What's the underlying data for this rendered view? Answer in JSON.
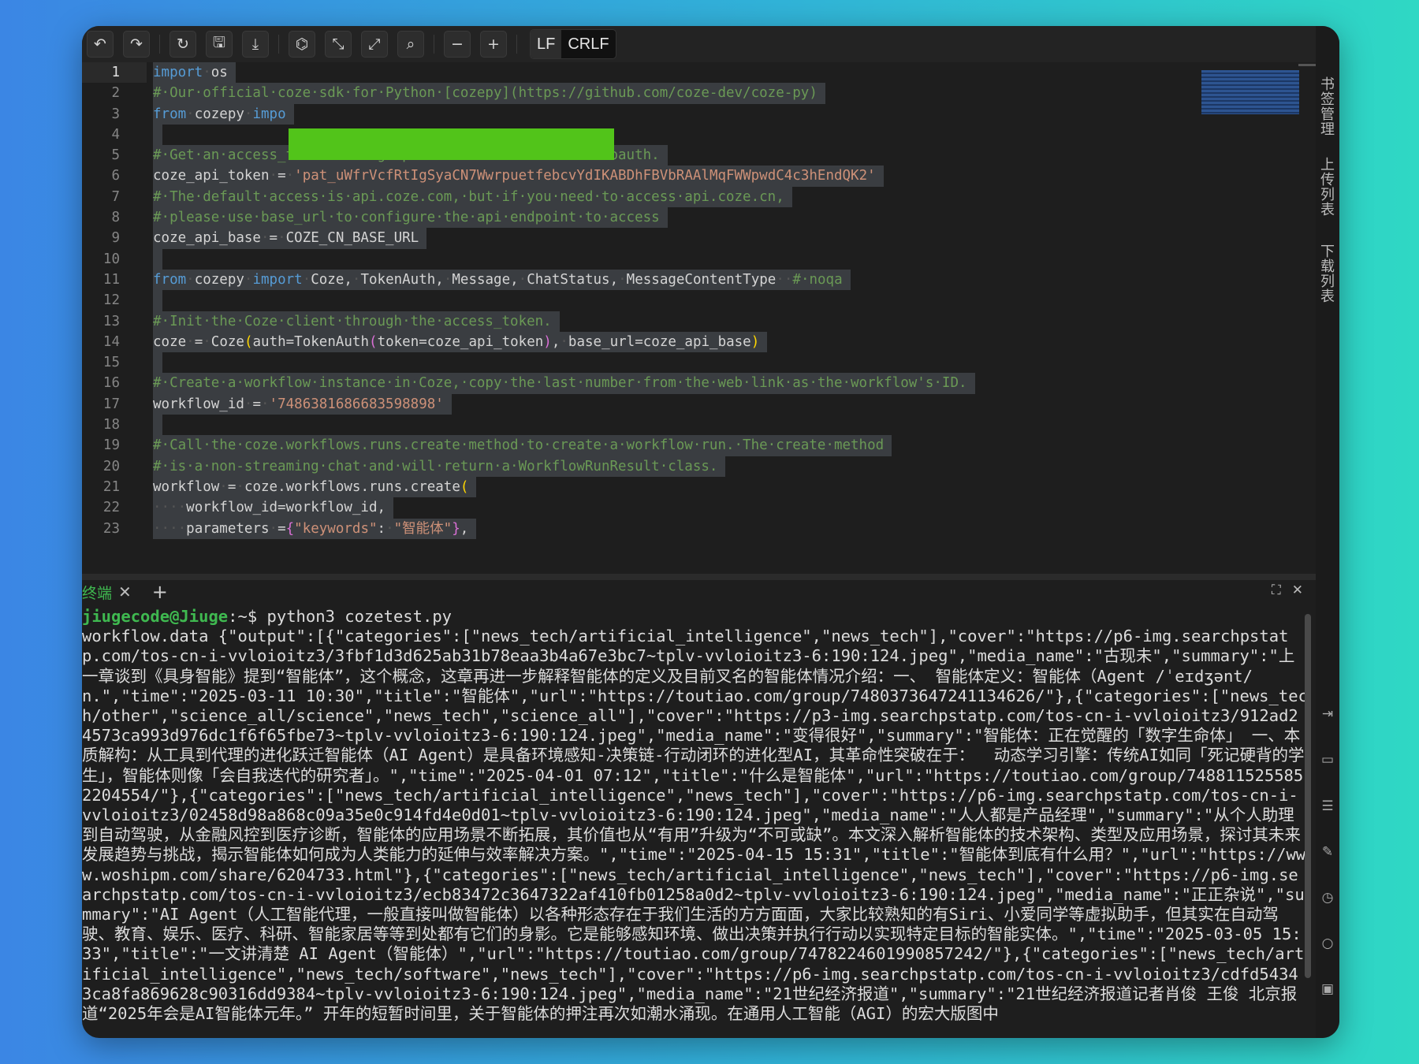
{
  "toolbar": {
    "buttons": [
      {
        "name": "undo-icon",
        "glyph": "↶"
      },
      {
        "name": "redo-icon",
        "glyph": "↷"
      },
      {
        "name": "refresh-icon",
        "glyph": "↻"
      },
      {
        "name": "save-icon",
        "glyph": "🖫"
      },
      {
        "name": "download-icon",
        "glyph": "⤓"
      },
      {
        "name": "compass-icon",
        "glyph": "⌬"
      },
      {
        "name": "collapse-icon",
        "glyph": "⤡"
      },
      {
        "name": "expand-icon",
        "glyph": "⤢"
      },
      {
        "name": "search-icon",
        "glyph": "⌕"
      },
      {
        "name": "zoom-out-icon",
        "glyph": "−"
      },
      {
        "name": "zoom-in-icon",
        "glyph": "+"
      }
    ],
    "eol_lf": "LF",
    "eol_crlf": "CRLF"
  },
  "editor": {
    "lines": [
      {
        "n": "1",
        "segments": [
          [
            "kw",
            "import"
          ],
          [
            "dot",
            "·"
          ],
          [
            "",
            "os"
          ]
        ]
      },
      {
        "n": "2",
        "segments": [
          [
            "cm",
            "#·Our·official·coze·sdk·for·Python·[cozepy](https://github.com/coze-dev/coze-py)"
          ]
        ]
      },
      {
        "n": "3",
        "segments": [
          [
            "kw",
            "from"
          ],
          [
            "dot",
            "·"
          ],
          [
            "",
            "cozepy"
          ],
          [
            "dot",
            "·"
          ],
          [
            "kw",
            "impo"
          ]
        ]
      },
      {
        "n": "4",
        "segments": []
      },
      {
        "n": "5",
        "segments": [
          [
            "cm",
            "#·Get·an·access_token·through·personal·access·token·or·oauth."
          ]
        ]
      },
      {
        "n": "6",
        "segments": [
          [
            "",
            "coze_api_token"
          ],
          [
            "dot",
            "·"
          ],
          [
            "",
            "="
          ],
          [
            "dot",
            "·"
          ],
          [
            "str",
            "'pat_uWfrVcfRtIgSyaCN7WwrpuetfebcvYdIKABDhFBVbRAAlMqFWWpwdC4c3hEndQK2'"
          ]
        ]
      },
      {
        "n": "7",
        "segments": [
          [
            "cm",
            "#·The·default·access·is·api.coze.com,·but·if·you·need·to·access·api.coze.cn,"
          ]
        ]
      },
      {
        "n": "8",
        "segments": [
          [
            "cm",
            "#·please·use·base_url·to·configure·the·api·endpoint·to·access"
          ]
        ]
      },
      {
        "n": "9",
        "segments": [
          [
            "",
            "coze_api_base"
          ],
          [
            "dot",
            "·"
          ],
          [
            "",
            "="
          ],
          [
            "dot",
            "·"
          ],
          [
            "",
            "COZE_CN_BASE_URL"
          ]
        ]
      },
      {
        "n": "10",
        "segments": []
      },
      {
        "n": "11",
        "segments": [
          [
            "kw",
            "from"
          ],
          [
            "dot",
            "·"
          ],
          [
            "",
            "cozepy"
          ],
          [
            "dot",
            "·"
          ],
          [
            "kw",
            "import"
          ],
          [
            "dot",
            "·"
          ],
          [
            "",
            "Coze,"
          ],
          [
            "dot",
            "·"
          ],
          [
            "",
            "TokenAuth,"
          ],
          [
            "dot",
            "·"
          ],
          [
            "",
            "Message,"
          ],
          [
            "dot",
            "·"
          ],
          [
            "",
            "ChatStatus,"
          ],
          [
            "dot",
            "·"
          ],
          [
            "",
            "MessageContentType"
          ],
          [
            "dot",
            "··"
          ],
          [
            "cm",
            "#·noqa"
          ]
        ]
      },
      {
        "n": "12",
        "segments": []
      },
      {
        "n": "13",
        "segments": [
          [
            "cm",
            "#·Init·the·Coze·client·through·the·access_token."
          ]
        ]
      },
      {
        "n": "14",
        "segments": [
          [
            "",
            "coze"
          ],
          [
            "dot",
            "·"
          ],
          [
            "",
            "="
          ],
          [
            "dot",
            "·"
          ],
          [
            "",
            "Coze"
          ],
          [
            "br-y",
            "("
          ],
          [
            "",
            "auth=TokenAuth"
          ],
          [
            "br-p",
            "("
          ],
          [
            "",
            "token=coze_api_token"
          ],
          [
            "br-p",
            ")"
          ],
          [
            "",
            ","
          ],
          [
            "dot",
            "·"
          ],
          [
            "",
            "base_url=coze_api_base"
          ],
          [
            "br-y",
            ")"
          ]
        ]
      },
      {
        "n": "15",
        "segments": []
      },
      {
        "n": "16",
        "segments": [
          [
            "cm",
            "#·Create·a·workflow·instance·in·Coze,·copy·the·last·number·from·the·web·link·as·the·workflow's·ID."
          ]
        ]
      },
      {
        "n": "17",
        "segments": [
          [
            "",
            "workflow_id"
          ],
          [
            "dot",
            "·"
          ],
          [
            "",
            "="
          ],
          [
            "dot",
            "·"
          ],
          [
            "str",
            "'7486381686683598898'"
          ]
        ]
      },
      {
        "n": "18",
        "segments": []
      },
      {
        "n": "19",
        "segments": [
          [
            "cm",
            "#·Call·the·coze.workflows.runs.create·method·to·create·a·workflow·run.·The·create·method"
          ]
        ]
      },
      {
        "n": "20",
        "segments": [
          [
            "cm",
            "#·is·a·non-streaming·chat·and·will·return·a·WorkflowRunResult·class."
          ]
        ]
      },
      {
        "n": "21",
        "segments": [
          [
            "",
            "workflow"
          ],
          [
            "dot",
            "·"
          ],
          [
            "",
            "="
          ],
          [
            "dot",
            "·"
          ],
          [
            "",
            "coze.workflows.runs.create"
          ],
          [
            "br-y",
            "("
          ]
        ]
      },
      {
        "n": "22",
        "segments": [
          [
            "dot",
            "····"
          ],
          [
            "",
            "workflow_id=workflow_id,"
          ]
        ]
      },
      {
        "n": "23",
        "segments": [
          [
            "dot",
            "····"
          ],
          [
            "",
            "parameters"
          ],
          [
            "dot",
            "·"
          ],
          [
            "",
            "="
          ],
          [
            "br-p",
            "{"
          ],
          [
            "str",
            "\"keywords\""
          ],
          [
            "",
            ":"
          ],
          [
            "dot",
            "·"
          ],
          [
            "str",
            "\"智能体\""
          ],
          [
            "br-p",
            "}"
          ],
          [
            "",
            ","
          ]
        ]
      }
    ]
  },
  "terminal": {
    "tab_label": "终端",
    "prompt_user": "jiugecode@Jiuge",
    "prompt_path": ":~$",
    "command": " python3 cozetest.py",
    "output": "workflow.data {\"output\":[{\"categories\":[\"news_tech/artificial_intelligence\",\"news_tech\"],\"cover\":\"https://p6-img.searchpstatp.com/tos-cn-i-vvloioitz3/3fbf1d3d625ab31b78eaa3b4a67e3bc7~tplv-vvloioitz3-6:190:124.jpeg\",\"media_name\":\"古现未\",\"summary\":\"上一章谈到《具身智能》提到“智能体”，这个概念，这章再进一步解释智能体的定义及目前叉名的智能体情况介绍：一、 智能体定义：智能体（Agent /ˈeɪdʒənt/ n.\",\"time\":\"2025-03-11 10:30\",\"title\":\"智能体\",\"url\":\"https://toutiao.com/group/7480373647241134626/\"},{\"categories\":[\"news_tech/other\",\"science_all/science\",\"news_tech\",\"science_all\"],\"cover\":\"https://p3-img.searchpstatp.com/tos-cn-i-vvloioitz3/912ad24573ca993d976dc1f6f65fbe73~tplv-vvloioitz3-6:190:124.jpeg\",\"media_name\":\"变得很好\",\"summary\":\"智能体：正在觉醒的「数字生命体」 一、本质解构：从工具到代理的进化跃迁智能体（AI Agent）是具备环境感知-决策链-行动闭环的进化型AI，其革命性突破在于：  动态学习引擎：传统AI如同「死记硬背的学生」，智能体则像「会自我迭代的研究者」。\",\"time\":\"2025-04-01 07:12\",\"title\":\"什么是智能体\",\"url\":\"https://toutiao.com/group/7488115255852204554/\"},{\"categories\":[\"news_tech/artificial_intelligence\",\"news_tech\"],\"cover\":\"https://p6-img.searchpstatp.com/tos-cn-i-vvloioitz3/02458d98a868c09a35e0c914fd4e0d01~tplv-vvloioitz3-6:190:124.jpeg\",\"media_name\":\"人人都是产品经理\",\"summary\":\"从个人助理到自动驾驶，从金融风控到医疗诊断，智能体的应用场景不断拓展，其价值也从“有用”升级为“不可或缺”。本文深入解析智能体的技术架构、类型及应用场景，探讨其未来发展趋势与挑战，揭示智能体如何成为人类能力的延伸与效率解决方案。\",\"time\":\"2025-04-15 15:31\",\"title\":\"智能体到底有什么用？\",\"url\":\"https://www.woshipm.com/share/6204733.html\"},{\"categories\":[\"news_tech/artificial_intelligence\",\"news_tech\"],\"cover\":\"https://p6-img.searchpstatp.com/tos-cn-i-vvloioitz3/ecb83472c3647322af410fb01258a0d2~tplv-vvloioitz3-6:190:124.jpeg\",\"media_name\":\"正正杂说\",\"summary\":\"AI Agent（人工智能代理，一般直接叫做智能体）以各种形态存在于我们生活的方方面面，大家比较熟知的有Siri、小爱同学等虚拟助手，但其实在自动驾驶、教育、娱乐、医疗、科研、智能家居等等到处都有它们的身影。它是能够感知环境、做出决策并执行行动以实现特定目标的智能实体。\",\"time\":\"2025-03-05 15:33\",\"title\":\"一文讲清楚 AI Agent（智能体）\",\"url\":\"https://toutiao.com/group/7478224601990857242/\"},{\"categories\":[\"news_tech/artificial_intelligence\",\"news_tech/software\",\"news_tech\"],\"cover\":\"https://p6-img.searchpstatp.com/tos-cn-i-vvloioitz3/cdfd54343ca8fa869628c90316dd9384~tplv-vvloioitz3-6:190:124.jpeg\",\"media_name\":\"21世纪经济报道\",\"summary\":\"21世纪经济报道记者肖俊 王俊 北京报道“2025年会是AI智能体元年。” 开年的短暂时间里，关于智能体的押注再次如潮水涌现。在通用人工智能（AGI）的宏大版图中"
  },
  "rail": {
    "label_top": "书签管理",
    "label_mid": "上传列表",
    "label_bot": "下载列表"
  }
}
